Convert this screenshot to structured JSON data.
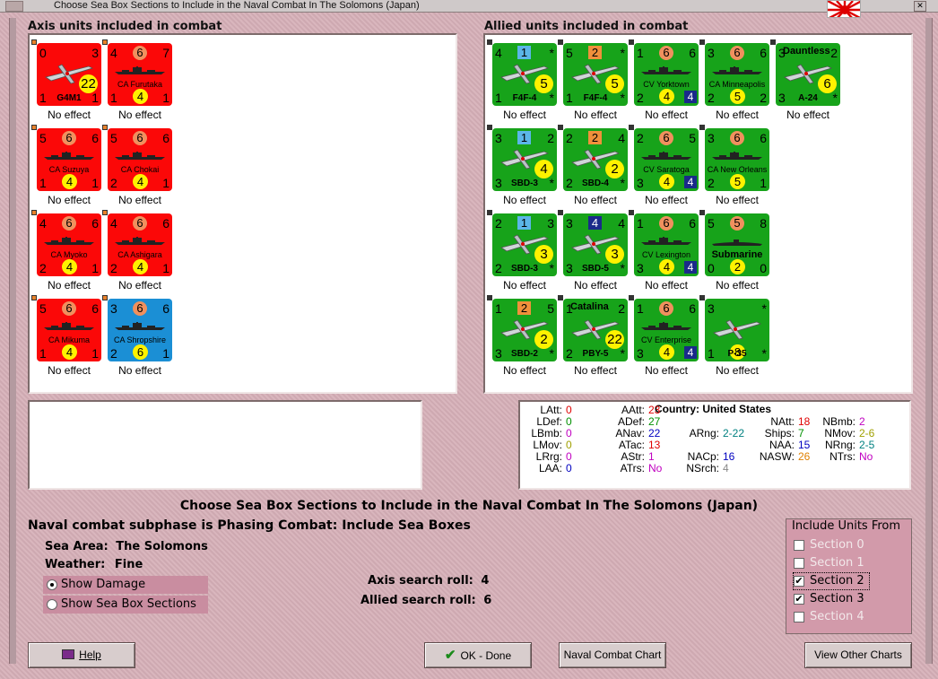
{
  "window": {
    "title": "Choose Sea Box Sections to Include in the Naval Combat In The Solomons (Japan)"
  },
  "axis": {
    "heading": "Axis units included in combat",
    "units": [
      {
        "name": "G4M1",
        "tl": "0",
        "tr": "3",
        "bl": "1",
        "br": "1",
        "rc": "22",
        "type": "air",
        "color": "red",
        "effect": "No effect"
      },
      {
        "name": "CA Furutaka",
        "tl": "4",
        "tc": "6",
        "tr": "7",
        "bl": "1",
        "bc": "4",
        "br": "1",
        "type": "ship",
        "color": "red",
        "effect": "No effect"
      },
      {
        "name": "CA Suzuya",
        "tl": "5",
        "tc": "6",
        "tr": "6",
        "bl": "1",
        "bc": "4",
        "br": "1",
        "type": "ship",
        "color": "red",
        "effect": "No effect"
      },
      {
        "name": "CA Chokai",
        "tl": "5",
        "tc": "6",
        "tr": "6",
        "bl": "2",
        "bc": "4",
        "br": "1",
        "type": "ship",
        "color": "red",
        "effect": "No effect"
      },
      {
        "name": "CA Myoko",
        "tl": "4",
        "tc": "6",
        "tr": "6",
        "bl": "2",
        "bc": "4",
        "br": "1",
        "type": "ship",
        "color": "red",
        "effect": "No effect"
      },
      {
        "name": "CA Ashigara",
        "tl": "4",
        "tc": "6",
        "tr": "6",
        "bl": "2",
        "bc": "4",
        "br": "1",
        "type": "ship",
        "color": "red",
        "effect": "No effect"
      },
      {
        "name": "CA Mikuma",
        "tl": "5",
        "tc": "6",
        "tr": "6",
        "bl": "1",
        "bc": "4",
        "br": "1",
        "type": "ship",
        "color": "red",
        "effect": "No effect"
      },
      {
        "name": "CA Shropshire",
        "tl": "3",
        "tc": "6",
        "tr": "6",
        "bl": "2",
        "bc": "6",
        "br": "1",
        "type": "ship",
        "color": "blue",
        "effect": "No effect"
      }
    ]
  },
  "allied": {
    "heading": "Allied units included in combat",
    "units": [
      {
        "name": "F4F-4",
        "tl": "4",
        "tsq": "1",
        "tsqc": "#5bb6e8",
        "tr": "*",
        "bl": "1",
        "br": "*",
        "rc": "5",
        "type": "air",
        "effect": "No effect"
      },
      {
        "name": "F4F-4",
        "tl": "5",
        "tsq": "2",
        "tsqc": "#f0903b",
        "tr": "*",
        "bl": "1",
        "br": "*",
        "rc": "5",
        "type": "air",
        "effect": "No effect"
      },
      {
        "name": "CV Yorktown",
        "tl": "1",
        "tc": "6",
        "tr": "6",
        "bl": "2",
        "bc": "4",
        "bsq": "4",
        "type": "ship",
        "effect": "No effect"
      },
      {
        "name": "CA Minneapolis",
        "tl": "3",
        "tc": "6",
        "tr": "6",
        "bl": "2",
        "bc": "5",
        "br": "2",
        "type": "ship",
        "effect": "No effect"
      },
      {
        "name": "A-24",
        "nmt": "Dauntless",
        "tl": "3",
        "tr": "2",
        "bl": "3",
        "br": "*",
        "rc": "6",
        "type": "air",
        "effect": "No effect"
      },
      {
        "name": "SBD-3",
        "tl": "3",
        "tsq": "1",
        "tsqc": "#5bb6e8",
        "tr": "2",
        "bl": "3",
        "br": "*",
        "rc": "4",
        "type": "air",
        "effect": "No effect"
      },
      {
        "name": "SBD-4",
        "tl": "2",
        "tsq": "2",
        "tsqc": "#f0903b",
        "tr": "4",
        "bl": "2",
        "br": "*",
        "rc": "2",
        "type": "air",
        "effect": "No effect"
      },
      {
        "name": "CV Saratoga",
        "tl": "2",
        "tc": "6",
        "tr": "5",
        "bl": "3",
        "bc": "4",
        "bsq": "4",
        "type": "ship",
        "effect": "No effect"
      },
      {
        "name": "CA New Orleans",
        "tl": "3",
        "tc": "6",
        "tr": "6",
        "bl": "2",
        "bc": "5",
        "br": "1",
        "type": "ship",
        "effect": "No effect"
      },
      {
        "name": "SBD-3",
        "tl": "2",
        "tsq": "1",
        "tsqc": "#5bb6e8",
        "tr": "3",
        "bl": "2",
        "br": "*",
        "rc": "3",
        "type": "air",
        "effect": "No effect"
      },
      {
        "name": "SBD-5",
        "tl": "3",
        "tsq": "4",
        "tsqc": "#1a2a8a",
        "tr": "4",
        "bl": "3",
        "br": "*",
        "rc": "3",
        "type": "air",
        "effect": "No effect"
      },
      {
        "name": "CV Lexington",
        "tl": "1",
        "tc": "6",
        "tr": "6",
        "bl": "3",
        "bc": "4",
        "bsq": "4",
        "type": "ship",
        "effect": "No effect"
      },
      {
        "name": "Submarine",
        "tl": "5",
        "tc": "5",
        "tr": "8",
        "bl": "0",
        "bc": "2",
        "br": "0",
        "type": "sub",
        "effect": "No effect"
      },
      {
        "name": "SBD-2",
        "tl": "1",
        "tsq": "2",
        "tsqc": "#f0903b",
        "tr": "5",
        "bl": "3",
        "br": "*",
        "rc": "2",
        "type": "air",
        "effect": "No effect"
      },
      {
        "name": "PBY-5",
        "nmt": "Catalina",
        "tl": "1",
        "tr": "2",
        "bl": "2",
        "br": "*",
        "rc": "22",
        "type": "air",
        "effect": "No effect"
      },
      {
        "name": "CV Enterprise",
        "tl": "1",
        "tc": "6",
        "tr": "6",
        "bl": "3",
        "bc": "4",
        "bsq": "4",
        "type": "ship",
        "effect": "No effect"
      },
      {
        "name": "P-35",
        "tl": "3",
        "tr": "*",
        "bl": "1",
        "bc": "8",
        "br": "*",
        "type": "air",
        "effect": "No effect"
      }
    ]
  },
  "stats": {
    "country_label": "Country:",
    "country": "United States",
    "items": [
      {
        "k": "LAtt:",
        "v": "0",
        "c": "#e00000"
      },
      {
        "k": "LDef:",
        "v": "0",
        "c": "#009000"
      },
      {
        "k": "LBmb:",
        "v": "0",
        "c": "#c000c0"
      },
      {
        "k": "LMov:",
        "v": "0",
        "c": "#a0a000"
      },
      {
        "k": "LRrg:",
        "v": "0",
        "c": "#c000c0"
      },
      {
        "k": "LAA:",
        "v": "0",
        "c": "#0000c0"
      },
      {
        "k": "AAtt:",
        "v": "23",
        "c": "#e00000"
      },
      {
        "k": "ADef:",
        "v": "27",
        "c": "#009000"
      },
      {
        "k": "ANav:",
        "v": "22",
        "c": "#0000c0"
      },
      {
        "k": "ATac:",
        "v": "13",
        "c": "#e00000"
      },
      {
        "k": "AStr:",
        "v": "1",
        "c": "#c000c0"
      },
      {
        "k": "ATrs:",
        "v": "No",
        "c": "#c000c0"
      },
      {
        "k": "ARng:",
        "v": "2-22",
        "c": "#008080"
      },
      {
        "k": "NACp:",
        "v": "16",
        "c": "#0000c0"
      },
      {
        "k": "NSrch:",
        "v": "4",
        "c": "#888888"
      },
      {
        "k": "NAtt:",
        "v": "18",
        "c": "#e00000"
      },
      {
        "k": "Ships:",
        "v": "7",
        "c": "#009000"
      },
      {
        "k": "NAA:",
        "v": "15",
        "c": "#0000c0"
      },
      {
        "k": "NASW:",
        "v": "26",
        "c": "#e08000"
      },
      {
        "k": "NBmb:",
        "v": "2",
        "c": "#c000c0"
      },
      {
        "k": "NMov:",
        "v": "2-6",
        "c": "#a0a000"
      },
      {
        "k": "NRng:",
        "v": "2-5",
        "c": "#008080"
      },
      {
        "k": "NTrs:",
        "v": "No",
        "c": "#c000c0"
      }
    ]
  },
  "main": {
    "title": "Choose Sea Box Sections to Include in the Naval Combat In The Solomons (Japan)",
    "subphase": "Naval combat subphase is Phasing Combat: Include Sea Boxes",
    "sea_area_label": "Sea Area:",
    "sea_area": "The Solomons",
    "weather_label": "Weather:",
    "weather": "Fine",
    "axis_roll_label": "Axis search roll:",
    "axis_roll": "4",
    "allied_roll_label": "Allied search roll:",
    "allied_roll": "6",
    "show_damage": "Show Damage",
    "show_sections": "Show Sea Box Sections"
  },
  "include": {
    "title": "Include Units From",
    "sections": [
      {
        "label": "Section 0",
        "checked": false,
        "enabled": false
      },
      {
        "label": "Section 1",
        "checked": false,
        "enabled": false
      },
      {
        "label": "Section 2",
        "checked": true,
        "enabled": true
      },
      {
        "label": "Section 3",
        "checked": true,
        "enabled": true
      },
      {
        "label": "Section 4",
        "checked": false,
        "enabled": false
      }
    ]
  },
  "buttons": {
    "help": "Help",
    "ok": "OK - Done",
    "naval_chart": "Naval Combat Chart",
    "other_charts": "View Other Charts"
  }
}
